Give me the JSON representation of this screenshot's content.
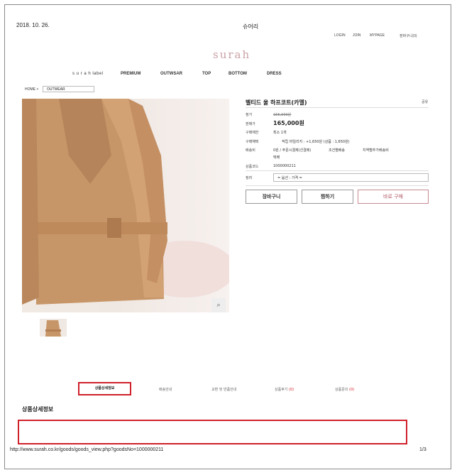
{
  "header": {
    "print_date": "2018. 10. 26.",
    "page_title": "슈어리",
    "util_links": [
      "LOGIN",
      "JOIN",
      "MYPAGE",
      "장바구니(0)"
    ],
    "logo": "surah"
  },
  "nav": {
    "items": [
      "s u r a h label",
      "PREMIUM",
      "OUTWSAR",
      "TOP",
      "BOTTOM",
      "DRESS"
    ]
  },
  "breadcrumb": {
    "home": "HOME >",
    "current": "OUTWEAR"
  },
  "product": {
    "name": "벨티드 울 하프코트(카멜)",
    "share": "공유",
    "rows": [
      {
        "label": "정가",
        "value": "155,000원"
      },
      {
        "label": "판매가",
        "value": "165,000원"
      },
      {
        "label": "구매제한",
        "value": "최소 1개"
      },
      {
        "label": "구매혜택",
        "value": "적립 마일리지 : +1,650원 (상품 : 1,650원)"
      },
      {
        "label": "배송비",
        "value": "0원  / 주문시결제(선결제)",
        "extra1": "조건별배송",
        "extra2": "지역별추가배송비",
        "extra3": "택배"
      },
      {
        "label": "상품코드",
        "value": "1000000211"
      }
    ],
    "option_label": "정려",
    "option_placeholder": "= 옵션 : 가격 =",
    "zoom_icon": "search-icon"
  },
  "buttons": {
    "cart": "장바구니",
    "wish": "찜하기",
    "buy": "바로 구매"
  },
  "tabs": [
    {
      "label": "상품상세정보",
      "active": true
    },
    {
      "label": "배송안내",
      "active": false
    },
    {
      "label": "교환 및 반품안내",
      "active": false
    },
    {
      "label": "상품후기",
      "count": "(0)",
      "active": false
    },
    {
      "label": "상품문의",
      "count": "(0)",
      "active": false
    }
  ],
  "detail": {
    "title": "상품상세정보"
  },
  "footer": {
    "url": "http://www.surah.co.kr/goods/goods_view.php?goodsNo=1000000211",
    "page": "1/3"
  },
  "colors": {
    "accent_red": "#d0202a",
    "logo_pink": "#c9a0a6",
    "coat_camel": "#c89468"
  }
}
